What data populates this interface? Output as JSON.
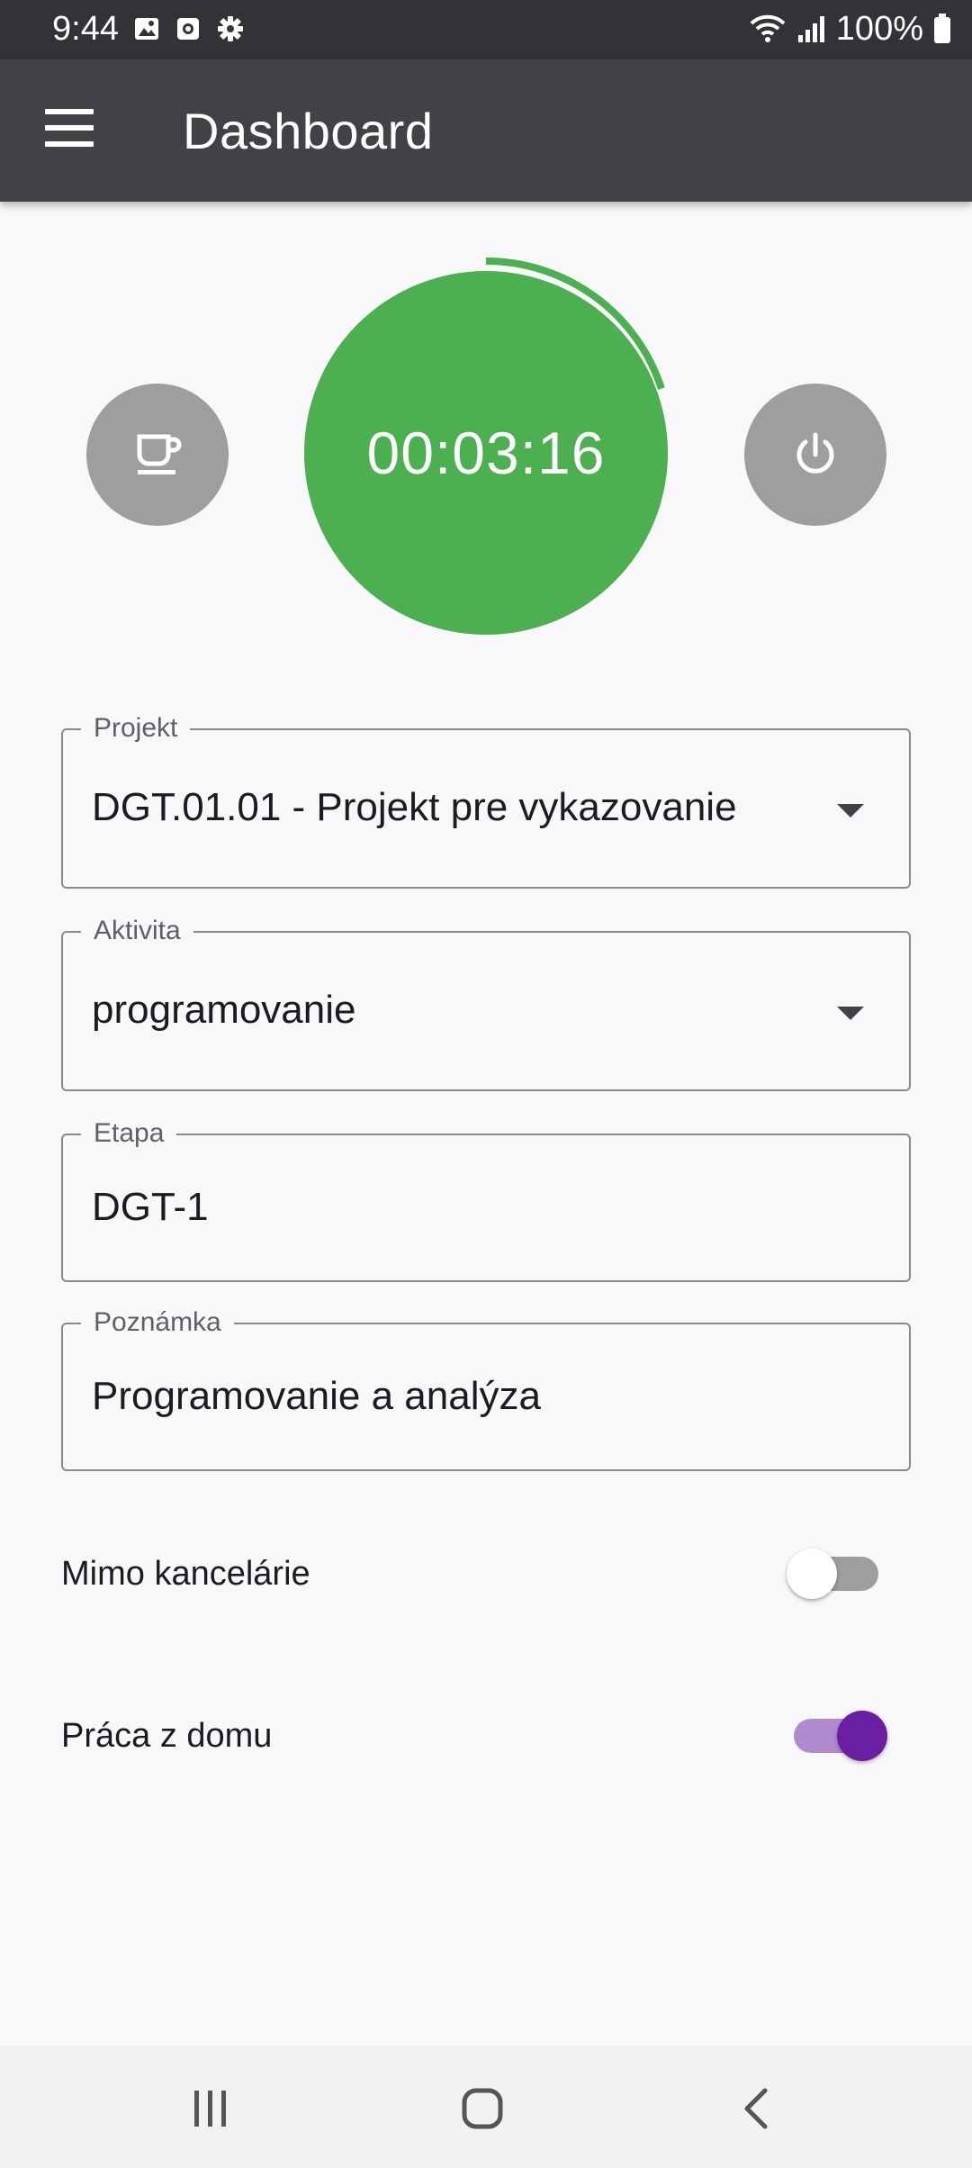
{
  "status_bar": {
    "time": "9:44",
    "battery_text": "100%",
    "left_icons": [
      "image-icon",
      "screen-record-icon",
      "settings-gear-icon"
    ],
    "right_icons": [
      "wifi-icon",
      "signal-icon",
      "battery-icon"
    ]
  },
  "app_bar": {
    "title": "Dashboard",
    "menu_icon": "hamburger-menu-icon"
  },
  "timer": {
    "elapsed": "00:03:16",
    "progress_fraction": 0.2,
    "color": "#4caf50",
    "left_button_icon": "coffee-cup-icon",
    "right_button_icon": "power-icon"
  },
  "form": {
    "projekt": {
      "label": "Projekt",
      "value": "DGT.01.01 - Projekt pre vykazovanie"
    },
    "aktivita": {
      "label": "Aktivita",
      "value": "programovanie"
    },
    "etapa": {
      "label": "Etapa",
      "value": "DGT-1"
    },
    "poznamka": {
      "label": "Poznámka",
      "value": "Programovanie a analýza"
    }
  },
  "switches": {
    "mimo_kancelarie": {
      "label": "Mimo kancelárie",
      "on": false
    },
    "praca_z_domu": {
      "label": "Práca z domu",
      "on": true
    }
  },
  "nav_bar": {
    "icons": [
      "recent-apps-icon",
      "home-icon",
      "back-icon"
    ]
  },
  "colors": {
    "accent_purple": "#6a1fa2",
    "timer_green": "#4caf50",
    "appbar": "#424146"
  }
}
